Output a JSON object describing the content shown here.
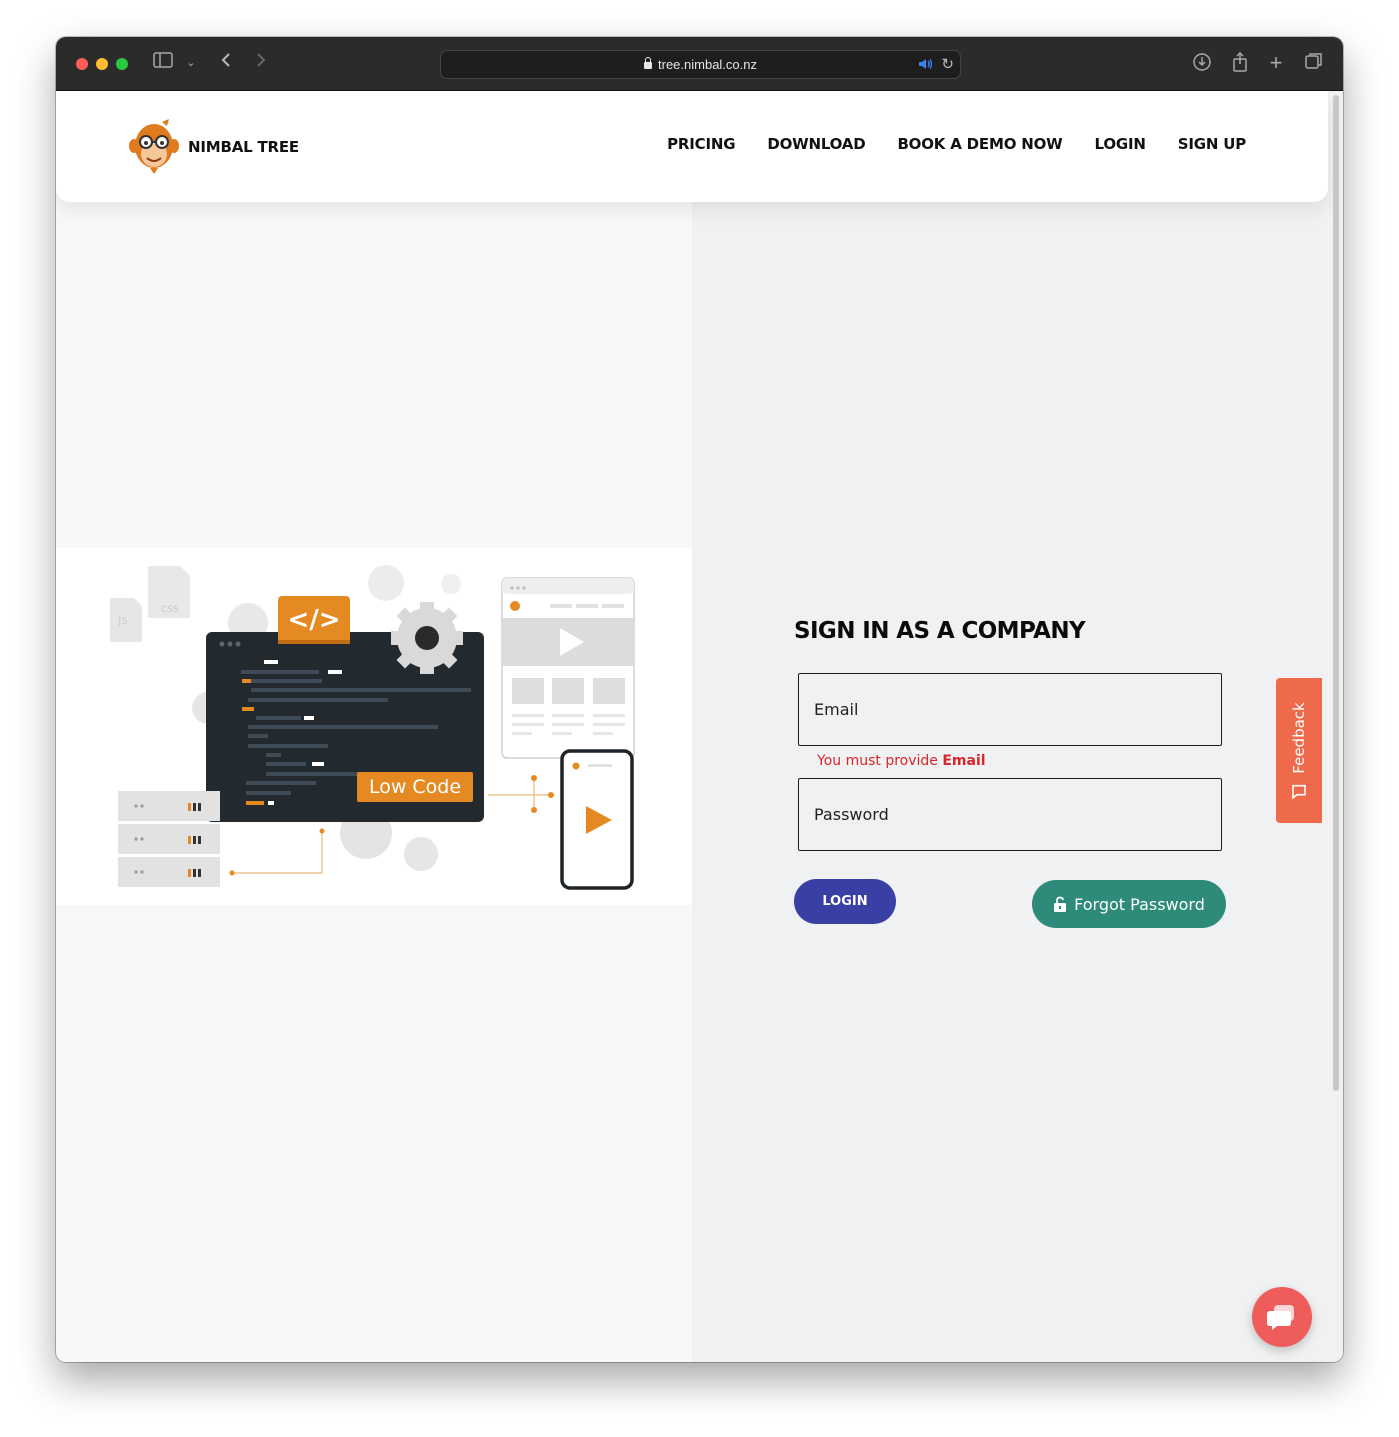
{
  "browser": {
    "url": "tree.nimbal.co.nz"
  },
  "navbar": {
    "brand": "NIMBAL TREE",
    "items": [
      {
        "label": "PRICING"
      },
      {
        "label": "DOWNLOAD"
      },
      {
        "label": "BOOK A DEMO NOW"
      },
      {
        "label": "LOGIN"
      },
      {
        "label": "SIGN UP"
      }
    ]
  },
  "illustration": {
    "badge_label": "Low Code",
    "code_tag": "</>"
  },
  "form": {
    "heading": "SIGN IN AS A COMPANY",
    "email_placeholder": "Email",
    "email_error_prefix": "You must provide ",
    "email_error_field": "Email",
    "password_placeholder": "Password",
    "login_label": "LOGIN",
    "forgot_label": "Forgot Password"
  },
  "feedback": {
    "label": "Feedback"
  },
  "colors": {
    "accent_orange": "#ef6a4b",
    "primary_blue": "#3a3fa5",
    "teal": "#2e8b7a",
    "error_red": "#d8262a"
  }
}
